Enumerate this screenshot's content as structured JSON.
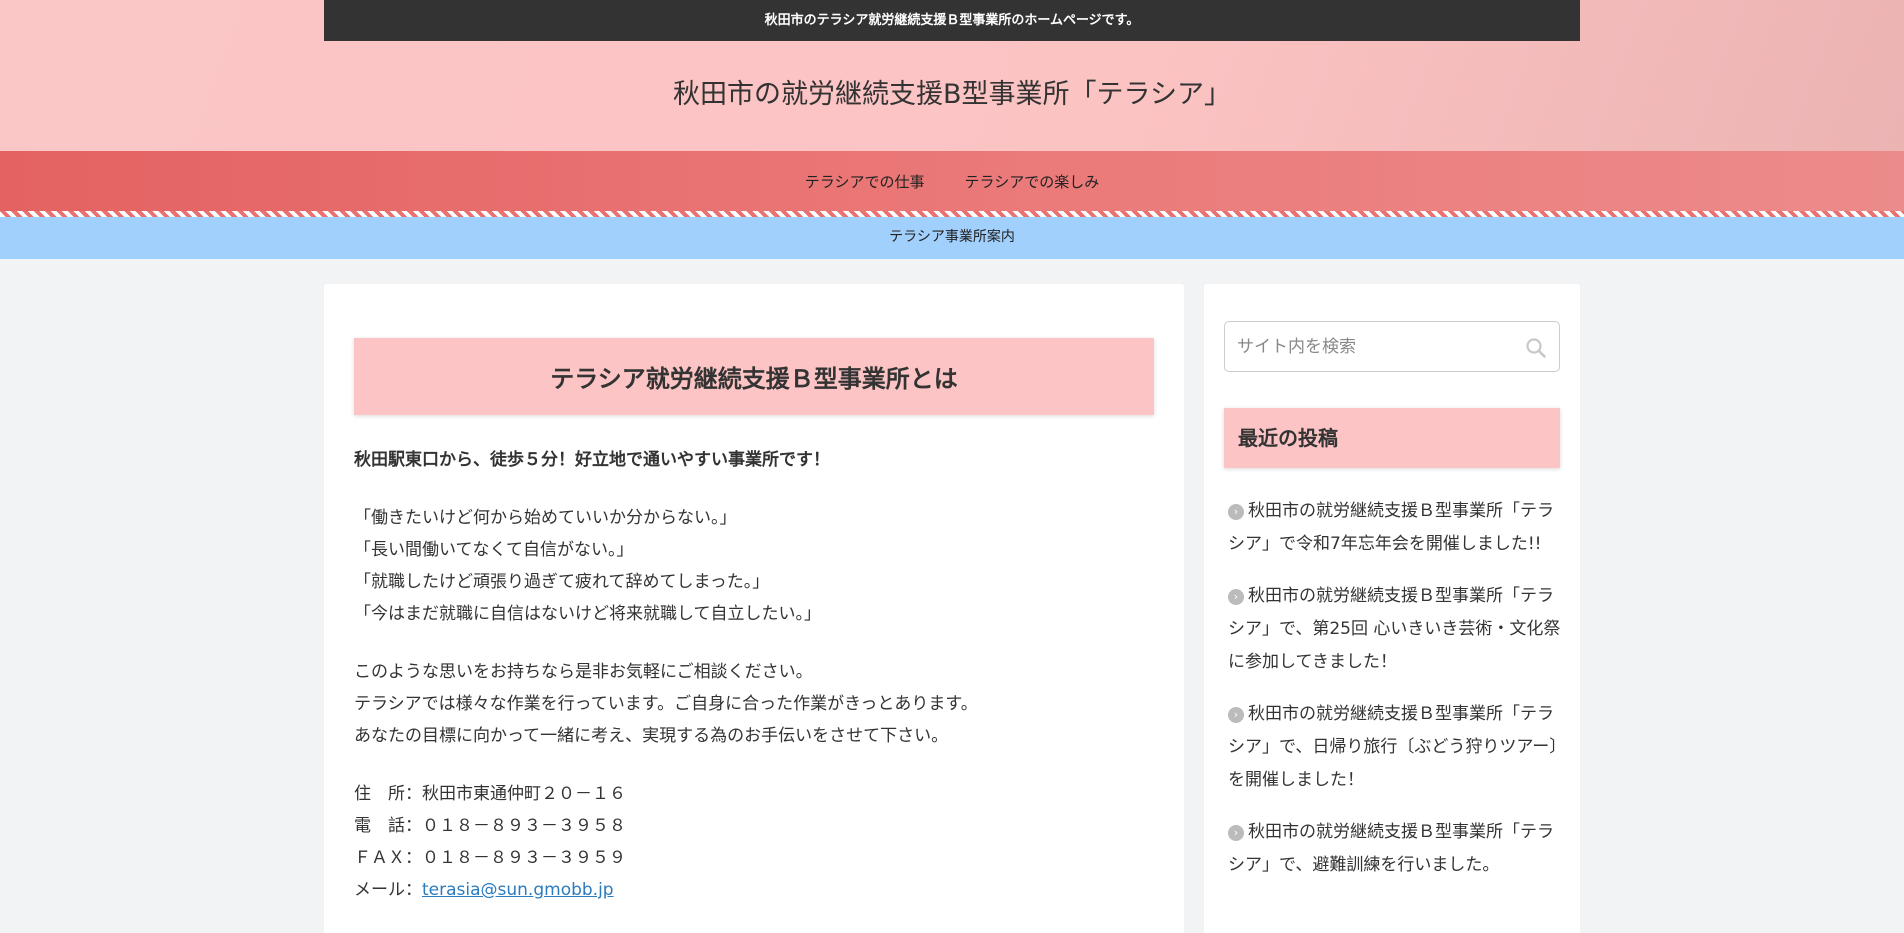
{
  "header": {
    "tagline": "秋田市のテラシア就労継続支援Ｂ型事業所のホームページです。",
    "site_title": "秋田市の就労継続支援B型事業所「テラシア」"
  },
  "nav": {
    "items": [
      {
        "label": "テラシアでの仕事"
      },
      {
        "label": "テラシアでの楽しみ"
      }
    ],
    "sub_item": "テラシア事業所案内"
  },
  "main": {
    "heading": "テラシア就労継続支援Ｂ型事業所とは",
    "lead": "秋田駅東口から、徒歩５分！好立地で通いやすい事業所です！",
    "quotes": [
      "「働きたいけど何から始めていいか分からない。」",
      "「長い間働いてなくて自信がない。」",
      "「就職したけど頑張り過ぎて疲れて辞めてしまった。」",
      "「今はまだ就職に自信はないけど将来就職して自立したい。」"
    ],
    "intro": [
      "このような思いをお持ちなら是非お気軽にご相談ください。",
      "テラシアでは様々な作業を行っています。ご自身に合った作業がきっとあります。",
      "あなたの目標に向かって一緒に考え、実現する為のお手伝いをさせて下さい。"
    ],
    "address": "住　所：秋田市東通仲町２０－１６",
    "phone": "電　話：０１８－８９３－３９５８",
    "fax": "ＦＡＸ：０１８－８９３－３９５９",
    "email_label": "メール：",
    "email": "terasia@sun.gmobb.jp"
  },
  "sidebar": {
    "search_placeholder": "サイト内を検索",
    "recent_title": "最近の投稿",
    "recent_posts": [
      "秋田市の就労継続支援Ｂ型事業所「テラシア」で令和7年忘年会を開催しました!!",
      "秋田市の就労継続支援Ｂ型事業所「テラシア」で、第25回 心いきいき芸術・文化祭に参加してきました！",
      "秋田市の就労継続支援Ｂ型事業所「テラシア」で、日帰り旅行〔ぶどう狩りツアー〕を開催しました！",
      "秋田市の就労継続支援Ｂ型事業所「テラシア」で、避難訓練を行いました。"
    ]
  },
  "icons": {
    "search": "search-icon",
    "bullet": "chevron-right-circle-icon"
  },
  "colors": {
    "header_bg": "#fcc3c3",
    "tagline_bar": "#333333",
    "nav_bg": "#e46262",
    "sub_nav_bg": "#a1d0fd",
    "heading_bg": "#fcc4c4",
    "link": "#2b7bbf"
  }
}
